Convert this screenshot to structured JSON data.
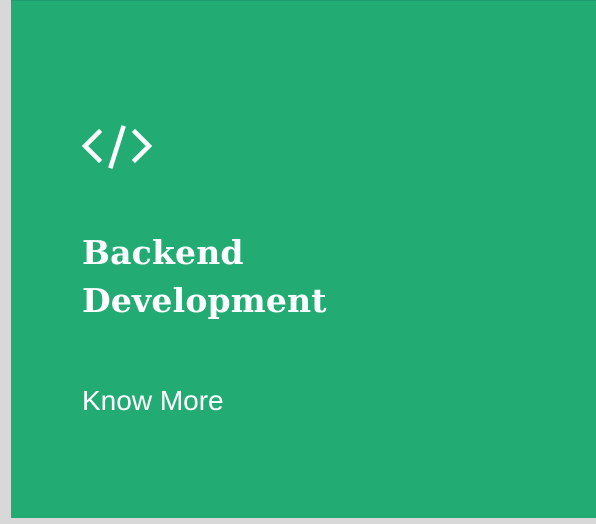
{
  "card": {
    "background": "#22ac74",
    "icon": "code-icon",
    "title_line1": "Backend",
    "title_line2": "Development",
    "link_label": "Know More",
    "text_color": "#ffffff"
  },
  "page": {
    "background": "#d8d8d8"
  }
}
